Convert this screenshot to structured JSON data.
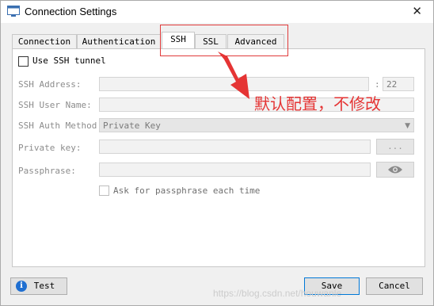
{
  "window": {
    "title": "Connection Settings",
    "close_glyph": "✕"
  },
  "tabs": [
    {
      "label": "Connection",
      "active": false
    },
    {
      "label": "Authentication",
      "active": false
    },
    {
      "label": "SSH",
      "active": true
    },
    {
      "label": "SSL",
      "active": false
    },
    {
      "label": "Advanced",
      "active": false
    }
  ],
  "ssh": {
    "use_tunnel_label": "Use SSH tunnel",
    "use_tunnel_checked": false,
    "address_label": "SSH Address:",
    "address_value": "",
    "port_separator": ":",
    "port_value": "22",
    "user_label": "SSH User Name:",
    "user_value": "",
    "auth_label": "SSH Auth Method:",
    "auth_value": "Private Key",
    "key_label": "Private key:",
    "key_value": "",
    "browse_label": "...",
    "passphrase_label": "Passphrase:",
    "passphrase_value": "",
    "ask_label": "Ask for passphrase each time",
    "ask_checked": false
  },
  "annotation": {
    "text": "默认配置，不修改",
    "color": "#e53434"
  },
  "footer": {
    "test_label": "Test",
    "save_label": "Save",
    "cancel_label": "Cancel"
  },
  "watermark": "https://blog.csdn.net/houwanle",
  "icons": {
    "app": "window-icon",
    "info": "info-icon",
    "eye": "eye-icon",
    "dropdown": "chevron-down-icon"
  },
  "colors": {
    "accent_border": "#0078d7",
    "highlight": "#e03b3b"
  }
}
